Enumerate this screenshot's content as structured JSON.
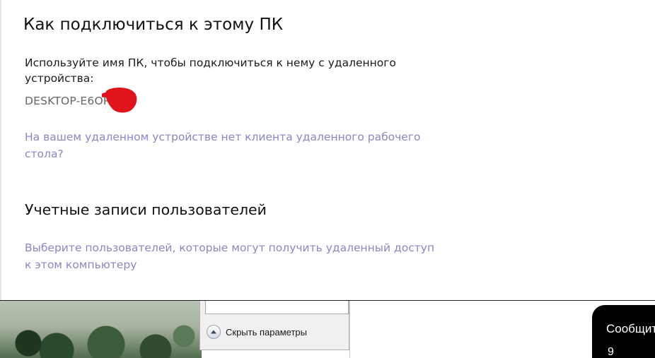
{
  "remote_desktop": {
    "connect_heading": "Как подключиться к этому ПК",
    "connect_description": "Используйте имя ПК, чтобы подключиться к нему с удаленного устройства:",
    "pc_name": "DESKTOP-E6OP",
    "no_client_link": "На вашем удаленном устройстве нет клиента удаленного рабочего стола?",
    "user_accounts_heading": "Учетные записи пользователей",
    "select_users_link": "Выберите пользователей, которые могут получить удаленный доступ к этом компьютеру"
  },
  "background_dialog": {
    "hide_params_label": "Скрыть параметры"
  },
  "notification": {
    "title": "Сообщит",
    "glyph": "9"
  },
  "colors": {
    "link": "#8a86c8",
    "redaction": "#e0141a",
    "toast_bg": "#000000"
  }
}
